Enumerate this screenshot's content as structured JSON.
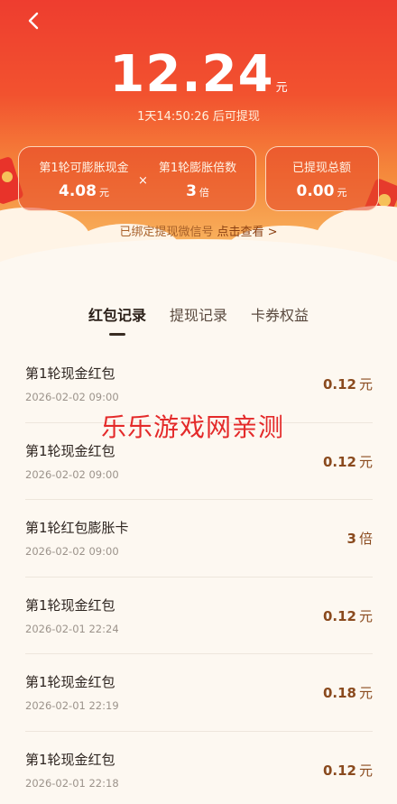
{
  "header": {
    "amount": "12.24",
    "amount_unit": "元",
    "countdown": "1天14:50:26 后可提现"
  },
  "cards": {
    "round_cash": {
      "label": "第1轮可膨胀现金",
      "value": "4.08",
      "unit": "元"
    },
    "times_symbol": "×",
    "multiplier": {
      "label": "第1轮膨胀倍数",
      "value": "3",
      "unit": "倍"
    },
    "withdrawn": {
      "label": "已提现总额",
      "value": "0.00",
      "unit": "元"
    }
  },
  "wechat": {
    "text": "已绑定提现微信号",
    "link": "点击查看 >"
  },
  "tabs": [
    {
      "label": "红包记录",
      "active": true
    },
    {
      "label": "提现记录",
      "active": false
    },
    {
      "label": "卡券权益",
      "active": false
    }
  ],
  "records": [
    {
      "title": "第1轮现金红包",
      "date": "2026-02-02 09:00",
      "value": "0.12",
      "unit": "元"
    },
    {
      "title": "第1轮现金红包",
      "date": "2026-02-02 09:00",
      "value": "0.12",
      "unit": "元"
    },
    {
      "title": "第1轮红包膨胀卡",
      "date": "2026-02-02 09:00",
      "value": "3",
      "unit": "倍"
    },
    {
      "title": "第1轮现金红包",
      "date": "2026-02-01 22:24",
      "value": "0.12",
      "unit": "元"
    },
    {
      "title": "第1轮现金红包",
      "date": "2026-02-01 22:19",
      "value": "0.18",
      "unit": "元"
    },
    {
      "title": "第1轮现金红包",
      "date": "2026-02-01 22:18",
      "value": "0.12",
      "unit": "元"
    }
  ],
  "watermark": "乐乐游戏网亲测",
  "colors": {
    "hero_top": "#ee3d2f",
    "accent": "#8a4a1e",
    "background": "#fdf8f1"
  }
}
